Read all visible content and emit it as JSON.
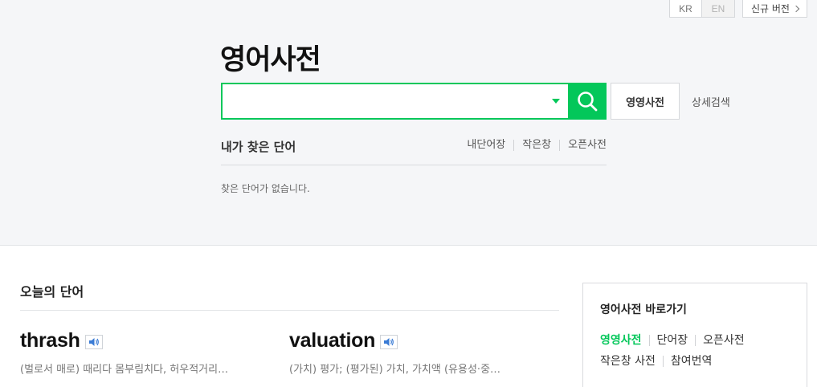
{
  "header": {
    "lang_kr": "KR",
    "lang_en": "EN",
    "new_version": "신규 버전"
  },
  "title": "영어사전",
  "search": {
    "value": "",
    "placeholder": "",
    "eng_eng_label": "영영사전",
    "detail_label": "상세검색"
  },
  "history": {
    "title": "내가 찾은 단어",
    "links": [
      "내단어장",
      "작은창",
      "오픈사전"
    ],
    "empty_text": "찾은 단어가 없습니다."
  },
  "today": {
    "title": "오늘의 단어",
    "words": [
      {
        "word": "thrash",
        "meaning": "(벌로서 매로) 때리다 몸부림치다, 허우적거리…"
      },
      {
        "word": "valuation",
        "meaning": "(가치) 평가; (평가된) 가치, 가치액 (유용성·중…"
      }
    ]
  },
  "shortcuts": {
    "title": "영어사전 바로가기",
    "items": [
      "영영사전",
      "단어장",
      "오픈사전",
      "작은창 사전",
      "참여번역"
    ]
  },
  "colors": {
    "accent": "#03c75a"
  }
}
